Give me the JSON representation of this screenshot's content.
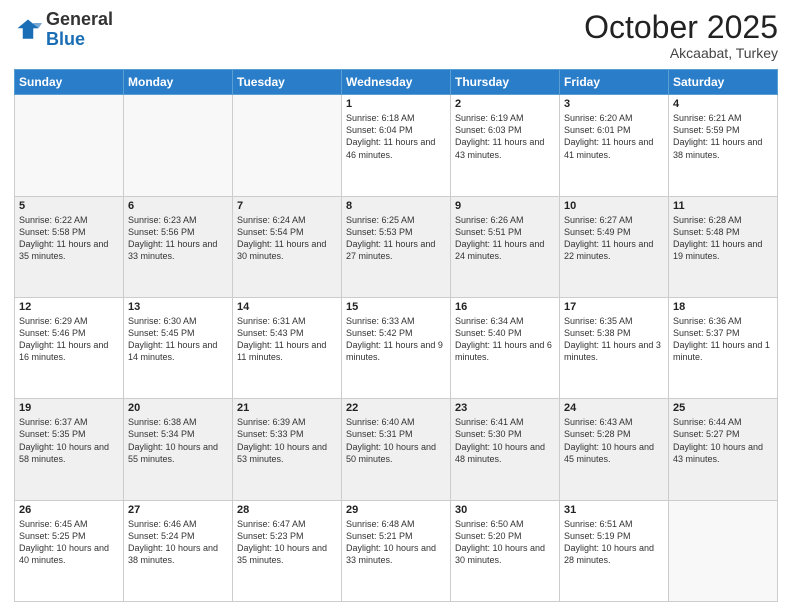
{
  "header": {
    "logo": {
      "general": "General",
      "blue": "Blue"
    },
    "title": "October 2025",
    "subtitle": "Akcaabat, Turkey"
  },
  "weekdays": [
    "Sunday",
    "Monday",
    "Tuesday",
    "Wednesday",
    "Thursday",
    "Friday",
    "Saturday"
  ],
  "weeks": [
    [
      {
        "day": "",
        "info": ""
      },
      {
        "day": "",
        "info": ""
      },
      {
        "day": "",
        "info": ""
      },
      {
        "day": "1",
        "info": "Sunrise: 6:18 AM\nSunset: 6:04 PM\nDaylight: 11 hours and 46 minutes."
      },
      {
        "day": "2",
        "info": "Sunrise: 6:19 AM\nSunset: 6:03 PM\nDaylight: 11 hours and 43 minutes."
      },
      {
        "day": "3",
        "info": "Sunrise: 6:20 AM\nSunset: 6:01 PM\nDaylight: 11 hours and 41 minutes."
      },
      {
        "day": "4",
        "info": "Sunrise: 6:21 AM\nSunset: 5:59 PM\nDaylight: 11 hours and 38 minutes."
      }
    ],
    [
      {
        "day": "5",
        "info": "Sunrise: 6:22 AM\nSunset: 5:58 PM\nDaylight: 11 hours and 35 minutes."
      },
      {
        "day": "6",
        "info": "Sunrise: 6:23 AM\nSunset: 5:56 PM\nDaylight: 11 hours and 33 minutes."
      },
      {
        "day": "7",
        "info": "Sunrise: 6:24 AM\nSunset: 5:54 PM\nDaylight: 11 hours and 30 minutes."
      },
      {
        "day": "8",
        "info": "Sunrise: 6:25 AM\nSunset: 5:53 PM\nDaylight: 11 hours and 27 minutes."
      },
      {
        "day": "9",
        "info": "Sunrise: 6:26 AM\nSunset: 5:51 PM\nDaylight: 11 hours and 24 minutes."
      },
      {
        "day": "10",
        "info": "Sunrise: 6:27 AM\nSunset: 5:49 PM\nDaylight: 11 hours and 22 minutes."
      },
      {
        "day": "11",
        "info": "Sunrise: 6:28 AM\nSunset: 5:48 PM\nDaylight: 11 hours and 19 minutes."
      }
    ],
    [
      {
        "day": "12",
        "info": "Sunrise: 6:29 AM\nSunset: 5:46 PM\nDaylight: 11 hours and 16 minutes."
      },
      {
        "day": "13",
        "info": "Sunrise: 6:30 AM\nSunset: 5:45 PM\nDaylight: 11 hours and 14 minutes."
      },
      {
        "day": "14",
        "info": "Sunrise: 6:31 AM\nSunset: 5:43 PM\nDaylight: 11 hours and 11 minutes."
      },
      {
        "day": "15",
        "info": "Sunrise: 6:33 AM\nSunset: 5:42 PM\nDaylight: 11 hours and 9 minutes."
      },
      {
        "day": "16",
        "info": "Sunrise: 6:34 AM\nSunset: 5:40 PM\nDaylight: 11 hours and 6 minutes."
      },
      {
        "day": "17",
        "info": "Sunrise: 6:35 AM\nSunset: 5:38 PM\nDaylight: 11 hours and 3 minutes."
      },
      {
        "day": "18",
        "info": "Sunrise: 6:36 AM\nSunset: 5:37 PM\nDaylight: 11 hours and 1 minute."
      }
    ],
    [
      {
        "day": "19",
        "info": "Sunrise: 6:37 AM\nSunset: 5:35 PM\nDaylight: 10 hours and 58 minutes."
      },
      {
        "day": "20",
        "info": "Sunrise: 6:38 AM\nSunset: 5:34 PM\nDaylight: 10 hours and 55 minutes."
      },
      {
        "day": "21",
        "info": "Sunrise: 6:39 AM\nSunset: 5:33 PM\nDaylight: 10 hours and 53 minutes."
      },
      {
        "day": "22",
        "info": "Sunrise: 6:40 AM\nSunset: 5:31 PM\nDaylight: 10 hours and 50 minutes."
      },
      {
        "day": "23",
        "info": "Sunrise: 6:41 AM\nSunset: 5:30 PM\nDaylight: 10 hours and 48 minutes."
      },
      {
        "day": "24",
        "info": "Sunrise: 6:43 AM\nSunset: 5:28 PM\nDaylight: 10 hours and 45 minutes."
      },
      {
        "day": "25",
        "info": "Sunrise: 6:44 AM\nSunset: 5:27 PM\nDaylight: 10 hours and 43 minutes."
      }
    ],
    [
      {
        "day": "26",
        "info": "Sunrise: 6:45 AM\nSunset: 5:25 PM\nDaylight: 10 hours and 40 minutes."
      },
      {
        "day": "27",
        "info": "Sunrise: 6:46 AM\nSunset: 5:24 PM\nDaylight: 10 hours and 38 minutes."
      },
      {
        "day": "28",
        "info": "Sunrise: 6:47 AM\nSunset: 5:23 PM\nDaylight: 10 hours and 35 minutes."
      },
      {
        "day": "29",
        "info": "Sunrise: 6:48 AM\nSunset: 5:21 PM\nDaylight: 10 hours and 33 minutes."
      },
      {
        "day": "30",
        "info": "Sunrise: 6:50 AM\nSunset: 5:20 PM\nDaylight: 10 hours and 30 minutes."
      },
      {
        "day": "31",
        "info": "Sunrise: 6:51 AM\nSunset: 5:19 PM\nDaylight: 10 hours and 28 minutes."
      },
      {
        "day": "",
        "info": ""
      }
    ]
  ]
}
